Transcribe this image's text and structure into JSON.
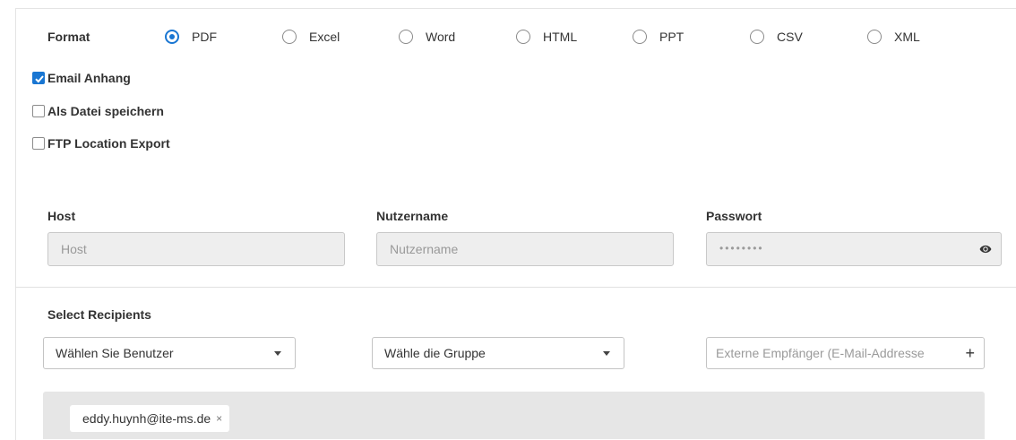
{
  "format": {
    "label": "Format",
    "options": [
      "PDF",
      "Excel",
      "Word",
      "HTML",
      "PPT",
      "CSV",
      "XML"
    ],
    "selected": "PDF"
  },
  "delivery": {
    "email_attachment": {
      "label": "Email Anhang",
      "checked": true
    },
    "save_as_file": {
      "label": "Als Datei speichern",
      "checked": false
    },
    "ftp_export": {
      "label": "FTP Location Export",
      "checked": false
    }
  },
  "ftp": {
    "host": {
      "label": "Host",
      "placeholder": "Host",
      "value": ""
    },
    "username": {
      "label": "Nutzername",
      "placeholder": "Nutzername",
      "value": ""
    },
    "password": {
      "label": "Passwort",
      "masked_value": "••••••••"
    }
  },
  "recipients": {
    "label": "Select Recipients",
    "users_select": "Wählen Sie Benutzer",
    "group_select": "Wähle die Gruppe",
    "external_placeholder": "Externe Empfänger (E-Mail-Addresse",
    "add_symbol": "+",
    "selected": [
      {
        "email": "eddy.huynh@ite-ms.de",
        "remove_symbol": "×"
      }
    ]
  },
  "colors": {
    "accent": "#1976d2",
    "input_bg": "#eeeeee",
    "chip_area_bg": "#e6e6e6"
  },
  "icons": {
    "password_toggle": "eye-icon",
    "dropdown": "caret-down-icon",
    "add": "plus-icon"
  }
}
